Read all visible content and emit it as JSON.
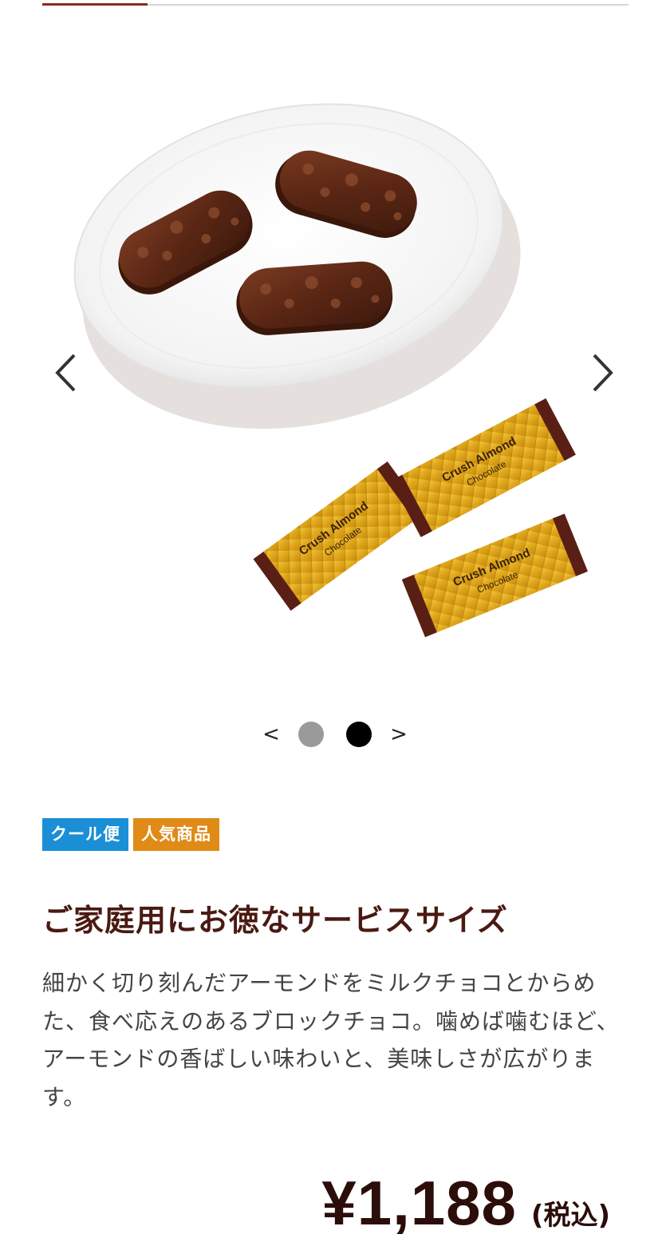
{
  "progress": {
    "fraction": 0.18
  },
  "carousel": {
    "prev_icon": "chevron-left-icon",
    "next_icon": "chevron-right-icon",
    "pager": {
      "prev_label": "<",
      "next_label": ">",
      "dots": [
        {
          "active": false,
          "color": "#9a9a9a"
        },
        {
          "active": true,
          "color": "#000000"
        }
      ]
    },
    "wrapper_text": [
      "Crush Almond",
      "Chocolate"
    ]
  },
  "badges": [
    {
      "label": "クール便",
      "color": "#1a8fd6"
    },
    {
      "label": "人気商品",
      "color": "#e08a17"
    }
  ],
  "product": {
    "title": "ご家庭用にお徳なサービスサイズ",
    "description": "細かく切り刻んだアーモンドをミルクチョコとからめた、食べ応えのあるブロックチョコ。噛めば噛むほど、アーモンドの香ばしい味わいと、美味しさが広がります。",
    "price": "¥1,188",
    "tax_note": "(税込)"
  },
  "colors": {
    "accent": "#8a2a1d",
    "title": "#4a1a12",
    "price": "#2b0d09"
  }
}
